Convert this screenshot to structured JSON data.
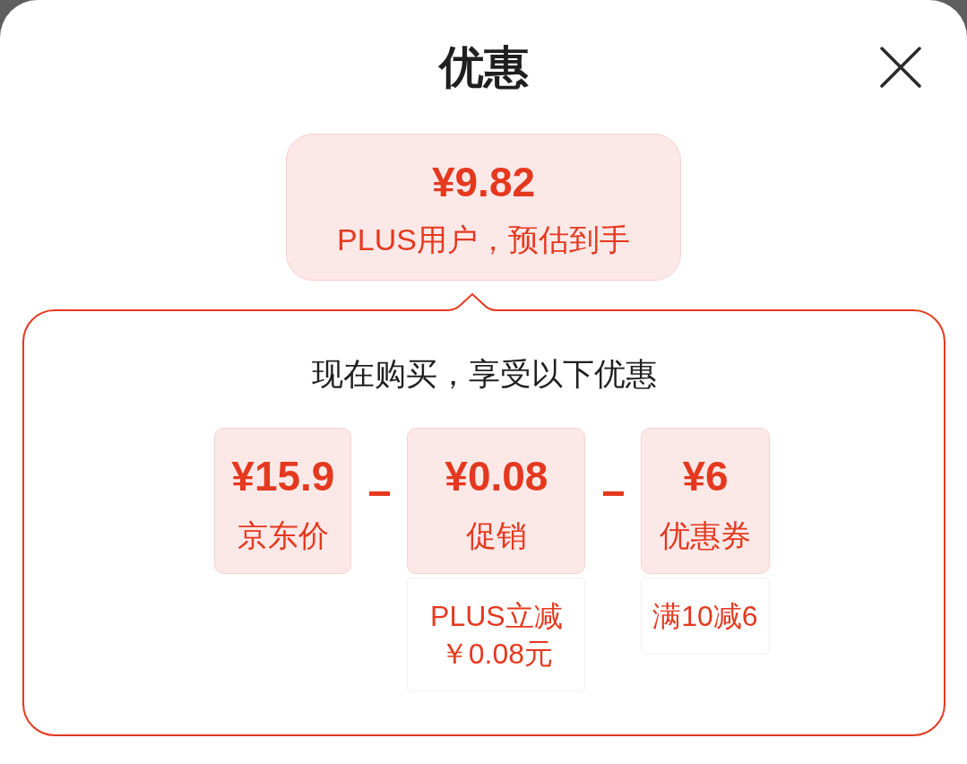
{
  "sheet": {
    "title": "优惠"
  },
  "estimate": {
    "price": "¥9.82",
    "caption": "PLUS用户，预估到手"
  },
  "breakdown": {
    "heading": "现在购买，享受以下优惠",
    "items": [
      {
        "amount": "¥15.9",
        "label": "京东价"
      },
      {
        "amount": "¥0.08",
        "label": "促销",
        "detail": "PLUS立减￥0.08元"
      },
      {
        "amount": "¥6",
        "label": "优惠券",
        "detail": "满10减6"
      }
    ]
  }
}
